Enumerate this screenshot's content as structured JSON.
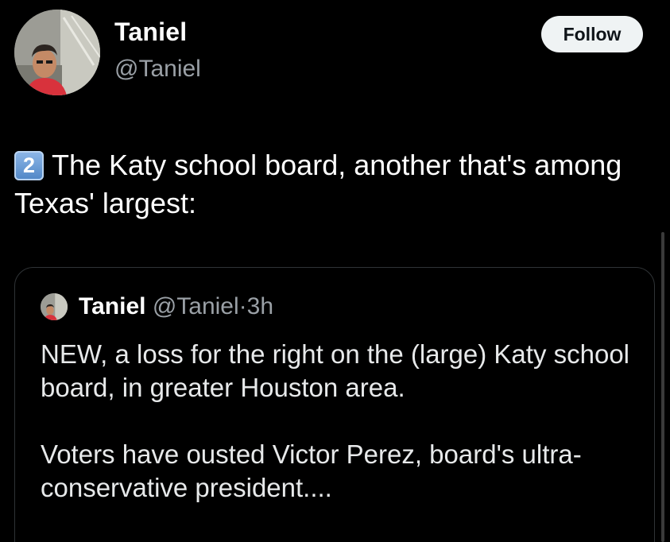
{
  "author": {
    "display_name": "Taniel",
    "handle": "@Taniel"
  },
  "follow_button": {
    "label": "Follow"
  },
  "tweet": {
    "keycap": "2",
    "text": "The Katy school board, another that's among Texas' largest:"
  },
  "quoted_tweet": {
    "display_name": "Taniel",
    "handle": "@Taniel",
    "separator": "·",
    "time": "3h",
    "paragraphs": [
      "NEW, a loss for the right on the (large) Katy school board, in greater Houston area.",
      "Voters have ousted Victor Perez, board's ultra-conservative president...."
    ]
  },
  "icons": {
    "keycap": "keycap-digit-two-icon"
  },
  "colors": {
    "background": "#000000",
    "primary_text": "#ffffff",
    "secondary_text": "#9aa0a6",
    "button_bg": "#eff3f4",
    "card_border": "#2f3336"
  }
}
